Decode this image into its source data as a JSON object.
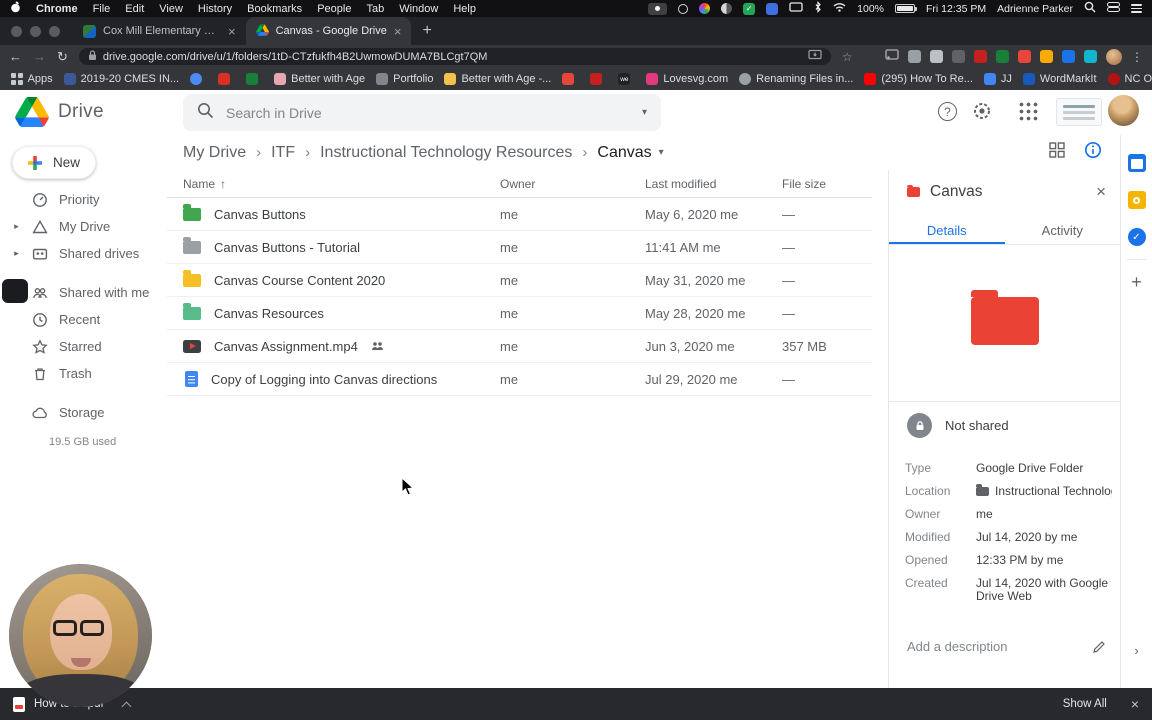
{
  "menubar": {
    "menus": [
      "Chrome",
      "File",
      "Edit",
      "View",
      "History",
      "Bookmarks",
      "People",
      "Tab",
      "Window",
      "Help"
    ],
    "battery": "100%",
    "clock": "Fri 12:35 PM",
    "user": "Adrienne Parker"
  },
  "browser": {
    "tabs": [
      {
        "title": "Cox Mill Elementary Homepag"
      },
      {
        "title": "Canvas - Google Drive"
      }
    ],
    "url": "drive.google.com/drive/u/1/folders/1tD-CTzfukfh4B2UwmowDUMA7BLCgt7QM",
    "apps_label": "Apps",
    "bookmarks": [
      {
        "label": "2019-20 CMES IN...",
        "style": "background:#3b5998"
      },
      {
        "label": "",
        "style": "background:#4c8bf5;border-radius:50%"
      },
      {
        "label": "",
        "style": "background:#d93025"
      },
      {
        "label": "",
        "style": "background:#188038"
      },
      {
        "label": "Better with Age",
        "style": "background:#e8a7b0"
      },
      {
        "label": "Portfolio",
        "style": "background:#80868b"
      },
      {
        "label": "Better with Age -...",
        "style": "background:#f2c14e"
      },
      {
        "label": "",
        "style": "background:#e8453c"
      },
      {
        "label": "",
        "style": "background:#c5221f"
      },
      {
        "label": "",
        "fav_text": "we",
        "style": "background:#202124"
      },
      {
        "label": "Lovesvg.com",
        "style": "background:#e5397f"
      },
      {
        "label": "Renaming Files in...",
        "style": "background:#9aa0a6;border-radius:50%"
      },
      {
        "label": "(295) How To Re...",
        "style": "background:#ff0000"
      },
      {
        "label": "JJ",
        "style": "background:#4285f4"
      },
      {
        "label": "WordMarkIt",
        "style": "background:#185abc"
      },
      {
        "label": "NC Office of Early...",
        "style": "background:#b31412;border-radius:50%"
      }
    ],
    "extensions": [
      {
        "style": "background:#9aa0a6"
      },
      {
        "style": "background:#bdc1c6"
      },
      {
        "style": "background:#5f6368"
      },
      {
        "style": "background:#c5221f"
      },
      {
        "style": "background:#188038"
      },
      {
        "style": "background:#e8453c"
      },
      {
        "style": "background:#f9ab00"
      },
      {
        "style": "background:#1a73e8"
      },
      {
        "style": "background:#12b5cb"
      }
    ]
  },
  "drive": {
    "product": "Drive",
    "search_placeholder": "Search in Drive",
    "breadcrumb": [
      "My Drive",
      "ITF",
      "Instructional Technology Resources"
    ],
    "current_folder": "Canvas",
    "columns": {
      "name": "Name",
      "owner": "Owner",
      "modified": "Last modified",
      "size": "File size"
    },
    "files": [
      {
        "name": "Canvas Buttons",
        "owner": "me",
        "modified": "May 6, 2020 me",
        "size": "—",
        "icon_style": "background:#41a64f"
      },
      {
        "name": "Canvas Buttons - Tutorial",
        "owner": "me",
        "modified": "11:41 AM me",
        "size": "—",
        "icon_style": "background:#9aa0a6"
      },
      {
        "name": "Canvas Course Content 2020",
        "owner": "me",
        "modified": "May 31, 2020 me",
        "size": "—",
        "icon_style": "background:#f6bf26"
      },
      {
        "name": "Canvas Resources",
        "owner": "me",
        "modified": "May 28, 2020 me",
        "size": "—",
        "icon_style": "background:#57bb8a"
      },
      {
        "name": "Canvas Assignment.mp4",
        "owner": "me",
        "modified": "Jun 3, 2020 me",
        "size": "357 MB"
      },
      {
        "name": "Copy of Logging into Canvas directions",
        "owner": "me",
        "modified": "Jul 29, 2020 me",
        "size": "—"
      }
    ],
    "sidebar": {
      "new_label": "New",
      "items": [
        "Priority",
        "My Drive",
        "Shared drives",
        "Shared with me",
        "Recent",
        "Starred",
        "Trash"
      ],
      "storage_label": "Storage",
      "storage_used": "19.5 GB used"
    },
    "panel": {
      "title": "Canvas",
      "folder_icon_style": "background:#ea4335",
      "tab_details": "Details",
      "tab_activity": "Activity",
      "shared_status": "Not shared",
      "fields": [
        {
          "label": "Type",
          "value": "Google Drive Folder"
        },
        {
          "label": "Location",
          "value": "Instructional Technology Resources"
        },
        {
          "label": "Owner",
          "value": "me"
        },
        {
          "label": "Modified",
          "value": "Jul 14, 2020 by me"
        },
        {
          "label": "Opened",
          "value": "12:33 PM by me"
        },
        {
          "label": "Created",
          "value": "Jul 14, 2020 with Google Drive Web"
        }
      ],
      "description_placeholder": "Add a description"
    }
  },
  "downloads": {
    "filename": "How to ….pdf",
    "show_all": "Show All"
  }
}
